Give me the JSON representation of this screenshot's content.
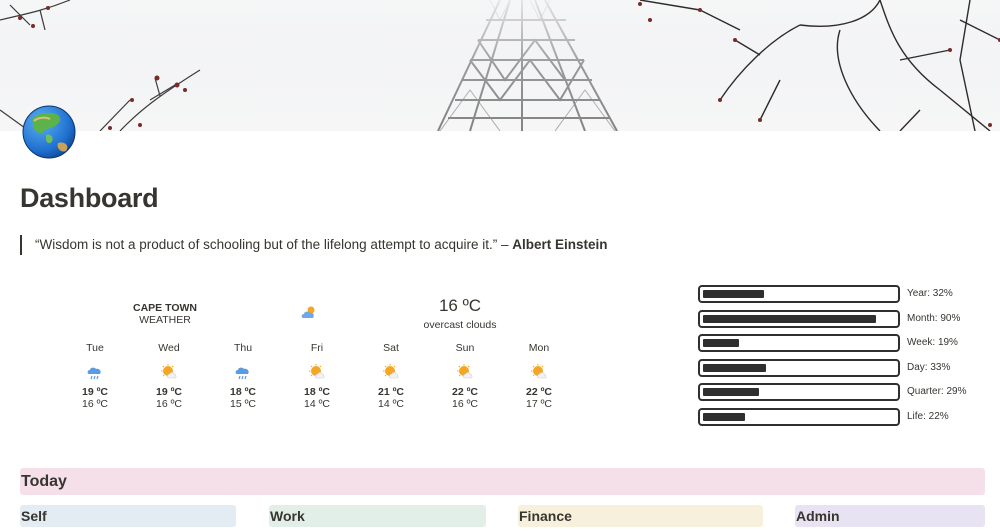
{
  "page": {
    "title": "Dashboard",
    "quote_text": "“Wisdom is not a product of schooling but of the lifelong attempt to acquire it.” – ",
    "quote_author": "Albert Einstein"
  },
  "weather": {
    "city": "CAPE TOWN",
    "city_sub": "WEATHER",
    "current_temp": "16 ºC",
    "current_desc": "overcast clouds",
    "current_icon": "cloud-sun-icon",
    "forecast": [
      {
        "day": "Tue",
        "icon": "rain-cloud-icon",
        "high": "19 ºC",
        "low": "16 ºC"
      },
      {
        "day": "Wed",
        "icon": "sun-cloud-icon",
        "high": "19 ºC",
        "low": "16 ºC"
      },
      {
        "day": "Thu",
        "icon": "rain-cloud-icon",
        "high": "18 ºC",
        "low": "15 ºC"
      },
      {
        "day": "Fri",
        "icon": "sun-cloud-icon",
        "high": "18 ºC",
        "low": "14 ºC"
      },
      {
        "day": "Sat",
        "icon": "sun-cloud-icon",
        "high": "21 ºC",
        "low": "14 ºC"
      },
      {
        "day": "Sun",
        "icon": "sun-cloud-icon",
        "high": "22 ºC",
        "low": "16 ºC"
      },
      {
        "day": "Mon",
        "icon": "sun-cloud-icon",
        "high": "22 ºC",
        "low": "17 ºC"
      }
    ]
  },
  "progress": [
    {
      "label": "Year: 32%",
      "value": 0.32
    },
    {
      "label": "Month: 90%",
      "value": 0.9
    },
    {
      "label": "Week: 19%",
      "value": 0.19
    },
    {
      "label": "Day: 33%",
      "value": 0.33
    },
    {
      "label": "Quarter: 29%",
      "value": 0.29
    },
    {
      "label": "Life: 22%",
      "value": 0.22
    }
  ],
  "sections": {
    "today": "Today",
    "self": "Self",
    "work": "Work",
    "finance": "Finance",
    "admin": "Admin"
  },
  "colors": {
    "today_bg": "#f5e0e9",
    "self_bg": "#e3ecf2",
    "work_bg": "#e2efe8",
    "finance_bg": "#f7f0dc",
    "admin_bg": "#e8e3f2",
    "bar_fill": "#2f2f2f"
  },
  "icons": {
    "page_icon": "globe-asia-icon"
  }
}
